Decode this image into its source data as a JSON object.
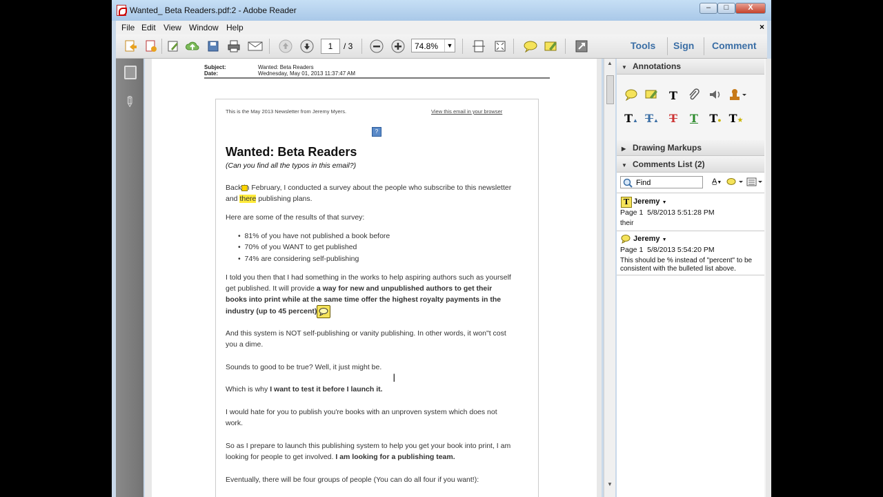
{
  "window": {
    "title": "Wanted_ Beta Readers.pdf:2 - Adobe Reader",
    "min_label": "–",
    "max_label": "□",
    "close_label": "X"
  },
  "menu": {
    "items": [
      "File",
      "Edit",
      "View",
      "Window",
      "Help"
    ],
    "close_label": "×"
  },
  "toolbar": {
    "page_current": "1",
    "page_total": "/ 3",
    "zoom": "74.8%",
    "right_buttons": [
      "Tools",
      "Sign",
      "Comment"
    ]
  },
  "document": {
    "header": {
      "subject_label": "Subject:",
      "subject_value": "Wanted: Beta Readers",
      "date_label": "Date:",
      "date_value": "Wednesday, May 01, 2013 11:37:47 AM"
    },
    "newsletter_note": "This is the May 2013 Newsletter from Jeremy Myers.",
    "browser_link": "View this email in your browser",
    "heading": "Wanted: Beta Readers",
    "subheading": "(Can you find all the typos in this email?)",
    "para1_a": "Back in February, I conducted a survey about the people who subscribe to this newsletter",
    "para1_b_pre": "and",
    "para1_b_hl": "there",
    "para1_b_post": "publishing plans.",
    "para2": "Here are some of the results of that survey:",
    "bullets": [
      "81% of you have not published a book before",
      "70% of you WANT to get published",
      "74% are considering self-publishing"
    ],
    "para3_a": "I told you then that I had something in the works to help aspiring authors such as yourself",
    "para3_b_pre": "get published. It will provide ",
    "para3_b_bold": "a way for new and unpublished authors to get their",
    "para3_c": "books into print while at the same time offer the highest royalty payments in the",
    "para3_d": "industry (up to 45 percent).",
    "para4_a": "And this system is NOT self-publishing or vanity publishing. In other words, it won\"t cost",
    "para4_b": "you a dime.",
    "para5": "Sounds to good to be true? Well, it just might be.",
    "para6_pre": "Which is why ",
    "para6_bold": "I want to test it before I launch it.",
    "para7_a": "I would hate for you to publish you're books with an unproven system which does not",
    "para7_b": "work.",
    "para8_a": "So as I prepare to launch this publishing system to help you get your book into print, I am",
    "para8_b_pre": "looking for people to get involved. ",
    "para8_b_bold": "I am looking for a publishing team.",
    "para9": "Eventually, there will be four groups of people (You can do all four if you want!):"
  },
  "panel": {
    "annotations_label": "Annotations",
    "drawing_label": "Drawing Markups",
    "comments_label": "Comments List (2)",
    "find_placeholder": "Find",
    "comments": [
      {
        "author": "Jeremy",
        "page": "Page 1",
        "time": "5/8/2013 5:51:28 PM",
        "body": "their"
      },
      {
        "author": "Jeremy",
        "page": "Page 1",
        "time": "5/8/2013 5:54:20 PM",
        "body": "This should be % instead of \"percent\" to be consistent with the bulleted list above."
      }
    ]
  }
}
